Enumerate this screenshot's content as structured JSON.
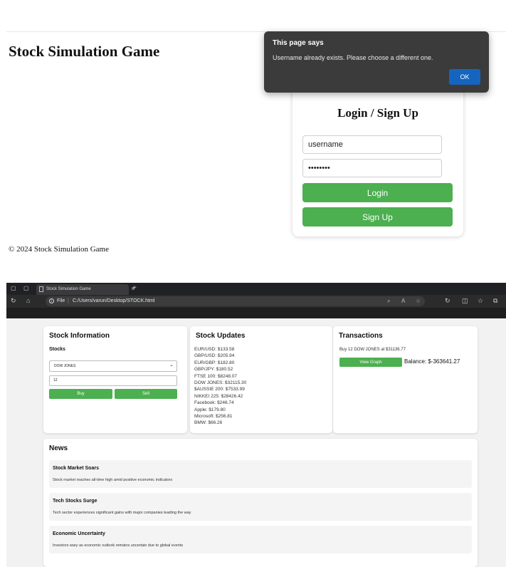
{
  "game": {
    "title": "Stock Simulation Game",
    "login": {
      "heading": "Login / Sign Up",
      "username_value": "username",
      "password_value": "••••••••",
      "login_label": "Login",
      "signup_label": "Sign Up"
    },
    "footer": "© 2024 Stock Simulation Game"
  },
  "dialog": {
    "title": "This page says",
    "message": "Username already exists. Please choose a different one.",
    "ok_label": "OK"
  },
  "browser": {
    "tab_title": "Stock Simulation Game",
    "tab_close": "×",
    "new_tab": "+",
    "url_scheme_label": "File",
    "url_separator": "|",
    "url_path": "C:/Users/varun/Desktop/STOCK.html",
    "url_info_glyph": "i"
  },
  "stock_info": {
    "heading": "Stock Information",
    "stocks_label": "Stocks",
    "selected_stock": "DOW JONES",
    "quantity": "12",
    "buy_label": "Buy",
    "sell_label": "Sell"
  },
  "stock_updates": {
    "heading": "Stock Updates",
    "items": [
      "EUR/USD: $133.58",
      "GBP/USD: $205.94",
      "EUR/GBP: $182.80",
      "GBP/JPY: $180.52",
      "FTSE 100: $8248.07",
      "DOW JONES: $32115.30",
      "$AUSSIE 200: $7533.99",
      "NIKKEI 225: $28426.42",
      "Facebook: $246.74",
      "Apple: $179.80",
      "Microsoft: $256.81",
      "BMW: $66.26"
    ]
  },
  "transactions": {
    "heading": "Transactions",
    "entry": "Buy 12 DOW JONES at $31136.77",
    "view_graph_label": "View Graph",
    "balance": "Balance: $-363641.27"
  },
  "news": {
    "heading": "News",
    "items": [
      {
        "title": "Stock Market Soars",
        "body": "Stock market reaches all-time high amid positive economic indicators"
      },
      {
        "title": "Tech Stocks Surge",
        "body": "Tech sector experiences significant gains with major companies leading the way"
      },
      {
        "title": "Economic Uncertainty",
        "body": "Investors wary as economic outlook remains uncertain due to global events"
      }
    ]
  },
  "icons": {
    "tab_actions": "▢",
    "tab_page": "▢",
    "refresh": "↻",
    "home": "⌂",
    "zoom": "⌕",
    "read_aloud": "A",
    "favorite": "☆",
    "refresh_alt": "↻",
    "split": "◫",
    "favorites_bar": "☆",
    "collections": "⧉",
    "chevron_down": "⌄"
  },
  "colors": {
    "button_green": "#4caf50",
    "dialog_bg": "#3b3b3b",
    "ok_blue": "#1565c0",
    "browser_dark": "#202124"
  }
}
